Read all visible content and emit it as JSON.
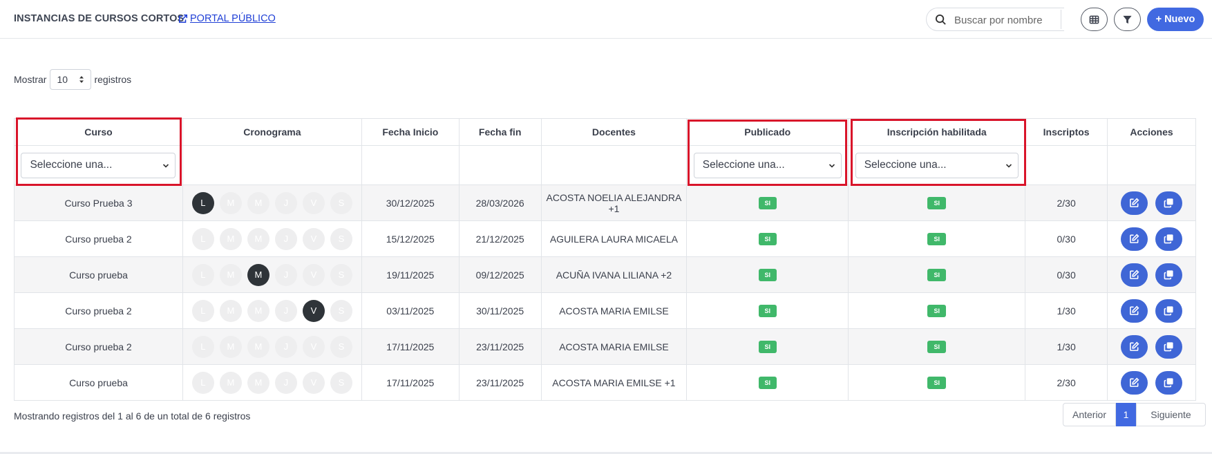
{
  "header": {
    "title": "INSTANCIAS DE CURSOS CORTOS",
    "portal_link": "PORTAL PÚBLICO",
    "search_placeholder": "Buscar por nombre",
    "new_button": "+ Nuevo"
  },
  "length_menu": {
    "prefix": "Mostrar",
    "value": "10",
    "suffix": "registros"
  },
  "table": {
    "columns": [
      "Curso",
      "Cronograma",
      "Fecha Inicio",
      "Fecha fin",
      "Docentes",
      "Publicado",
      "Inscripción habilitada",
      "Inscriptos",
      "Acciones"
    ],
    "filters": {
      "curso": "Seleccione una...",
      "publicado": "Seleccione una...",
      "inscripcion": "Seleccione una..."
    },
    "day_letters": [
      "L",
      "M",
      "M",
      "J",
      "V",
      "S"
    ],
    "rows": [
      {
        "curso": "Curso Prueba 3",
        "days_on": [
          true,
          false,
          false,
          false,
          false,
          false
        ],
        "inicio": "30/12/2025",
        "fin": "28/03/2026",
        "docentes": "ACOSTA NOELIA ALEJANDRA +1",
        "publicado": "SI",
        "inscripcion": "SI",
        "inscriptos": "2/30"
      },
      {
        "curso": "Curso prueba 2",
        "days_on": [
          false,
          false,
          false,
          false,
          false,
          false
        ],
        "inicio": "15/12/2025",
        "fin": "21/12/2025",
        "docentes": "AGUILERA LAURA MICAELA",
        "publicado": "SI",
        "inscripcion": "SI",
        "inscriptos": "0/30"
      },
      {
        "curso": "Curso prueba",
        "days_on": [
          false,
          false,
          true,
          false,
          false,
          false
        ],
        "inicio": "19/11/2025",
        "fin": "09/12/2025",
        "docentes": "ACUÑA IVANA LILIANA +2",
        "publicado": "SI",
        "inscripcion": "SI",
        "inscriptos": "0/30"
      },
      {
        "curso": "Curso prueba 2",
        "days_on": [
          false,
          false,
          false,
          false,
          true,
          false
        ],
        "inicio": "03/11/2025",
        "fin": "30/11/2025",
        "docentes": "ACOSTA MARIA EMILSE",
        "publicado": "SI",
        "inscripcion": "SI",
        "inscriptos": "1/30"
      },
      {
        "curso": "Curso prueba 2",
        "days_on": [
          false,
          false,
          false,
          false,
          false,
          false
        ],
        "inicio": "17/11/2025",
        "fin": "23/11/2025",
        "docentes": "ACOSTA MARIA EMILSE",
        "publicado": "SI",
        "inscripcion": "SI",
        "inscriptos": "1/30"
      },
      {
        "curso": "Curso prueba",
        "days_on": [
          false,
          false,
          false,
          false,
          false,
          false
        ],
        "inicio": "17/11/2025",
        "fin": "23/11/2025",
        "docentes": "ACOSTA MARIA EMILSE +1",
        "publicado": "SI",
        "inscripcion": "SI",
        "inscriptos": "2/30"
      }
    ]
  },
  "footer": {
    "info": "Mostrando registros del 1 al 6 de un total de 6 registros",
    "prev": "Anterior",
    "page": "1",
    "next": "Siguiente"
  },
  "colors": {
    "primary": "#4169e1",
    "badge_green": "#40b86a",
    "highlight_red": "#d9142a",
    "day_active": "#2f3439"
  },
  "icons": {
    "search": "search-icon",
    "external": "external-link-icon",
    "columns": "table-grid-icon",
    "filter": "filter-icon",
    "edit": "edit-icon",
    "copy": "copy-icon"
  }
}
